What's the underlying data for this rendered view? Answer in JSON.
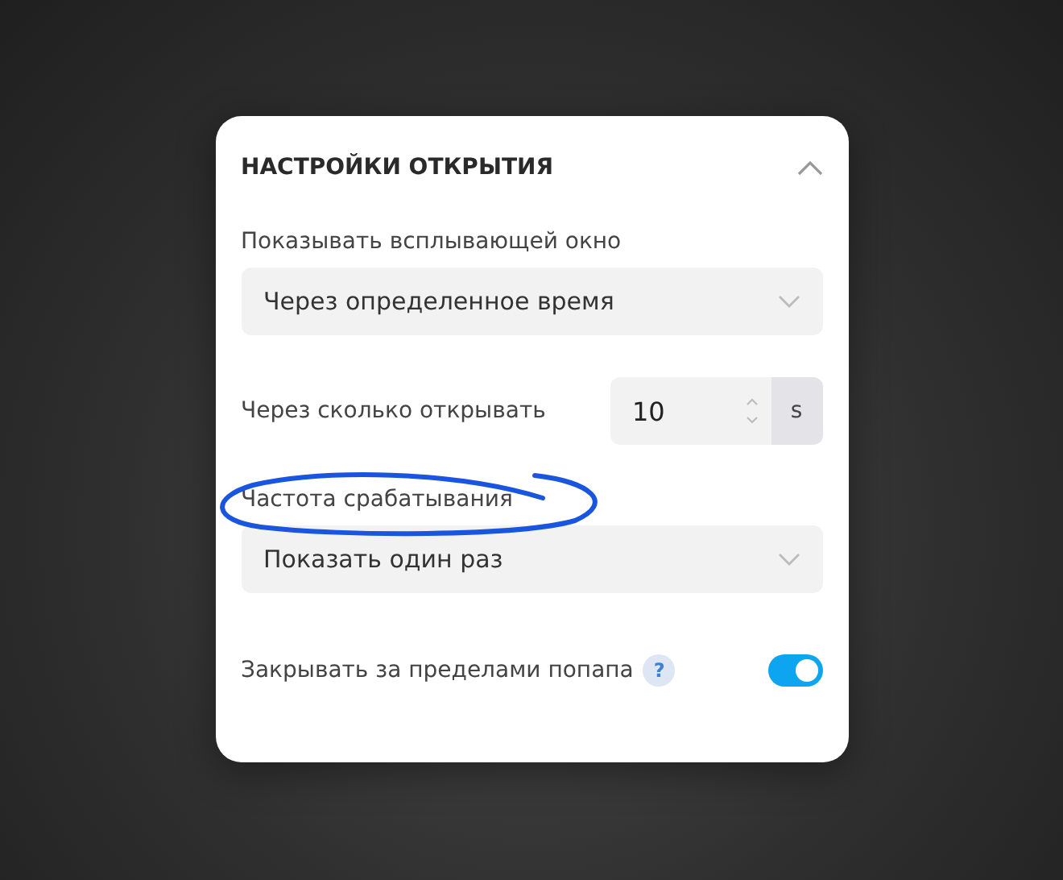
{
  "panel": {
    "title": "НАСТРОЙКИ ОТКРЫТИЯ",
    "expanded": true
  },
  "show_popup": {
    "label": "Показывать всплывающей окно",
    "value": "Через определенное время"
  },
  "delay": {
    "label": "Через сколько открывать",
    "value": "10",
    "unit": "s"
  },
  "frequency": {
    "label": "Частота срабатывания",
    "value": "Показать один раз",
    "highlighted": true
  },
  "close_outside": {
    "label": "Закрывать за пределами попапа",
    "help": "?",
    "on": true
  }
}
